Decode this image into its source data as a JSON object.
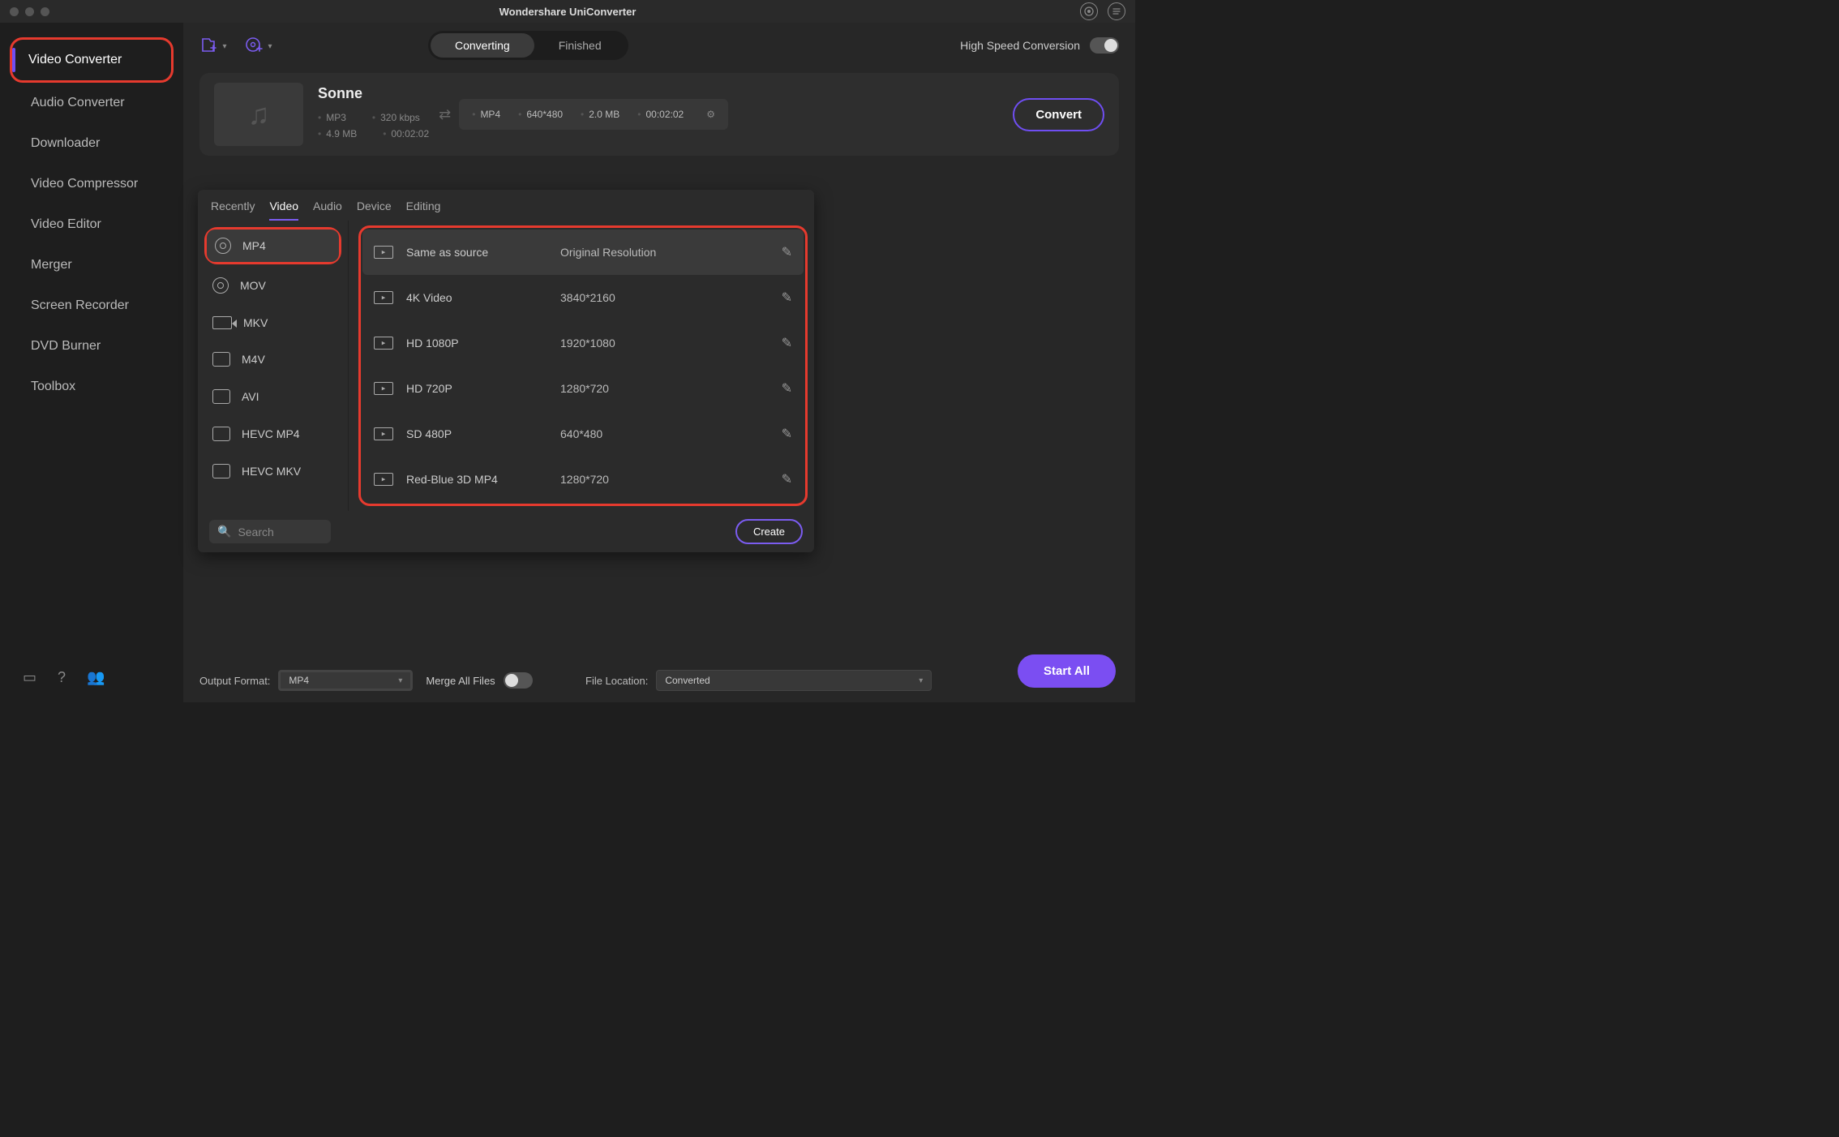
{
  "app_title": "Wondershare UniConverter",
  "sidebar": {
    "items": [
      {
        "label": "Video Converter",
        "active": true,
        "highlighted": true
      },
      {
        "label": "Audio Converter"
      },
      {
        "label": "Downloader"
      },
      {
        "label": "Video Compressor"
      },
      {
        "label": "Video Editor"
      },
      {
        "label": "Merger"
      },
      {
        "label": "Screen Recorder"
      },
      {
        "label": "DVD Burner"
      },
      {
        "label": "Toolbox"
      }
    ]
  },
  "toolbar": {
    "tabs": {
      "converting": "Converting",
      "finished": "Finished"
    },
    "hs_label": "High Speed Conversion"
  },
  "file": {
    "title": "Sonne",
    "src": {
      "format": "MP3",
      "bitrate": "320 kbps",
      "size": "4.9 MB",
      "duration": "00:02:02"
    },
    "out": {
      "format": "MP4",
      "resolution": "640*480",
      "size": "2.0 MB",
      "duration": "00:02:02"
    },
    "convert_label": "Convert"
  },
  "format_panel": {
    "tabs": [
      "Recently",
      "Video",
      "Audio",
      "Device",
      "Editing"
    ],
    "active_tab": "Video",
    "formats": [
      "MP4",
      "MOV",
      "MKV",
      "M4V",
      "AVI",
      "HEVC MP4",
      "HEVC MKV"
    ],
    "active_format": "MP4",
    "presets": [
      {
        "name": "Same as source",
        "res": "Original Resolution",
        "active": true
      },
      {
        "name": "4K Video",
        "res": "3840*2160"
      },
      {
        "name": "HD 1080P",
        "res": "1920*1080"
      },
      {
        "name": "HD 720P",
        "res": "1280*720"
      },
      {
        "name": "SD 480P",
        "res": "640*480"
      },
      {
        "name": "Red-Blue 3D MP4",
        "res": "1280*720"
      }
    ],
    "search_placeholder": "Search",
    "create_label": "Create"
  },
  "bottom": {
    "output_format_label": "Output Format:",
    "output_format_value": "MP4",
    "file_location_label": "File Location:",
    "file_location_value": "Converted",
    "merge_label": "Merge All Files",
    "start_label": "Start All"
  }
}
